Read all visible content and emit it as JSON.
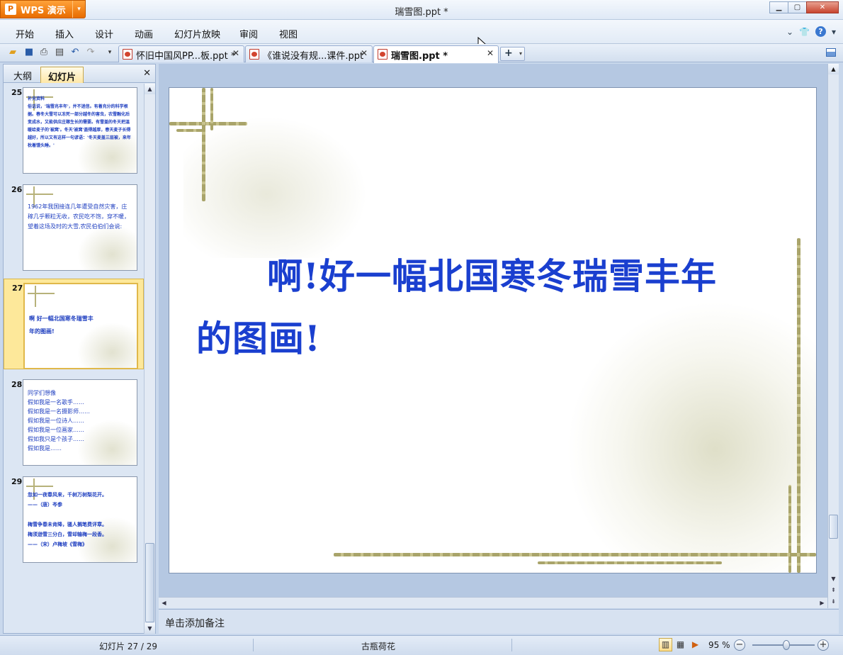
{
  "app": {
    "name": "WPS 演示",
    "title": "瑞雪图.ppt *"
  },
  "menu": [
    "开始",
    "插入",
    "设计",
    "动画",
    "幻灯片放映",
    "审阅",
    "视图"
  ],
  "tabs": [
    {
      "label": "怀旧中国风PP...板.ppt *"
    },
    {
      "label": "《谁说没有规...课件.ppt"
    },
    {
      "label": "瑞雪图.ppt *"
    }
  ],
  "pane": {
    "tab_outline": "大纲",
    "tab_slides": "幻灯片"
  },
  "thumbnails": [
    {
      "num": "25",
      "text": "补充资料\n  俗话说，'瑞雪兆丰年'，并不迷信。有着充分的科学根据。春冬大雪可以冻死一部分越冬的害虫，农雪融化后变成水，又能供应庄稼生长的需要。有雪盖的冬天把温暖给麦子的'被窝'。冬天'被窝'盖得越厚，春天麦子长得越好，所以又有这样一句谚语：'冬天麦盖三层被，来年枕着馒头睡。'"
    },
    {
      "num": "26",
      "text": "  1962年我国接连几年遭受自然灾害，庄稼几乎颗粒无收，农民吃不饱，穿不暖，望着这场及时的大雪,农民伯伯们会说:"
    },
    {
      "num": "27",
      "text": "   啊 好一幅北国寒冬瑞雪丰\n年的图画!"
    },
    {
      "num": "28",
      "text": "同学们想像\n假如我是一名歌手……\n假如我是一名摄影师……\n假如我是一位诗人……\n假如我是一位画家……\n假如我只是个孩子……\n假如我是……"
    },
    {
      "num": "29",
      "text": "忽如一夜春风来，千树万树梨花开。\n           ——（唐）岑参\n\n梅雪争春未肯降，骚人搁笔费评章。\n梅须逊雪三分白，雪却输梅一段香。\n        ——（宋）卢梅坡《雪梅》"
    }
  ],
  "slide": {
    "title": "啊!好一幅北国寒冬瑞雪丰年的图画!"
  },
  "notes_placeholder": "单击添加备注",
  "status": {
    "slide_counter": "幻灯片 27 / 29",
    "theme": "古瓶荷花",
    "zoom": "95 %",
    "zoom_level": 0.55
  }
}
